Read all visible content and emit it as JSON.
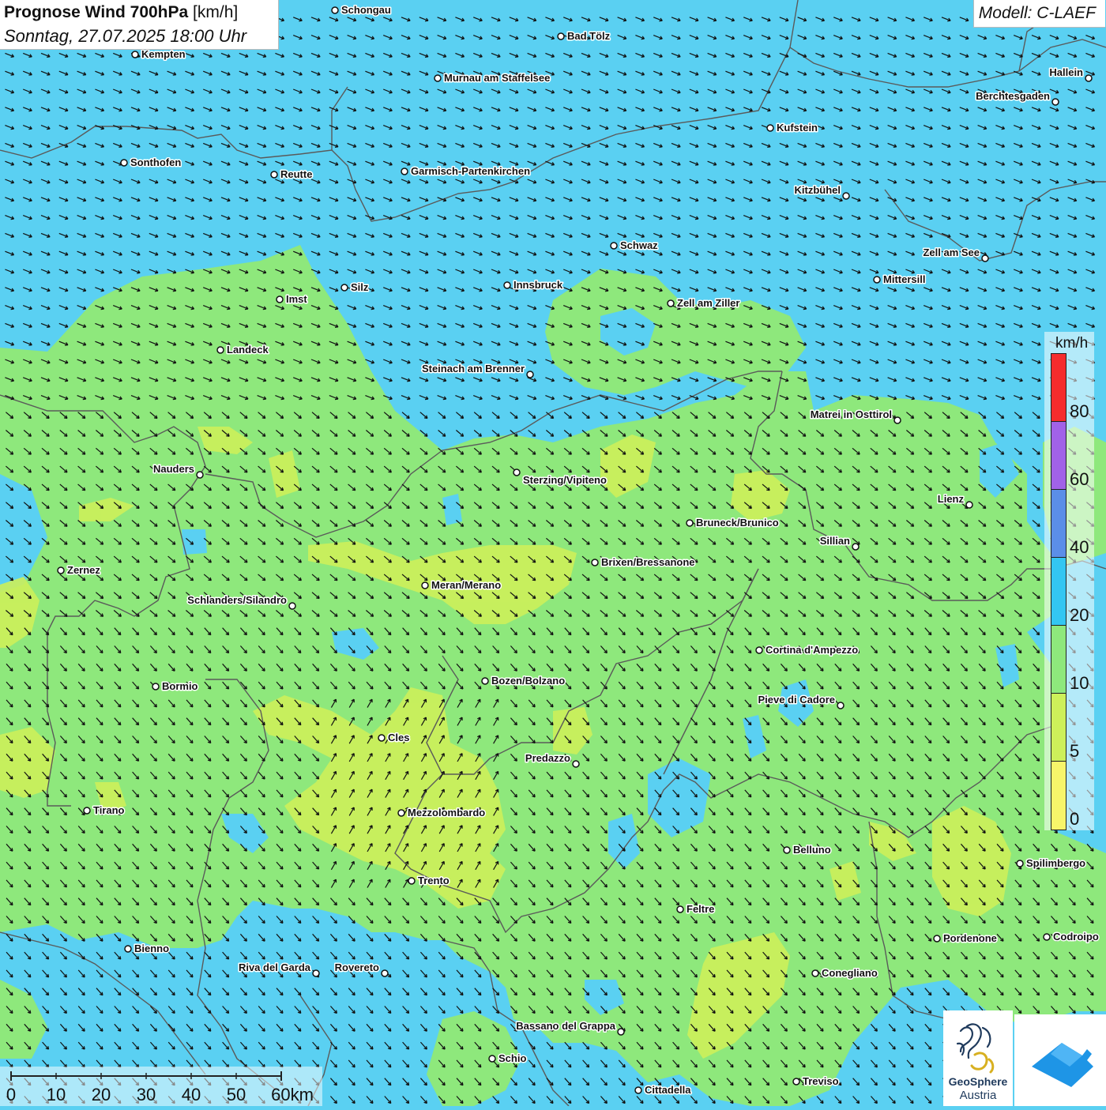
{
  "header": {
    "title_bold": "Prognose Wind 700hPa",
    "title_unit": "[km/h]",
    "datetime": "Sonntag, 27.07.2025 18:00 Uhr",
    "model": "Modell: C-LAEF"
  },
  "legend": {
    "unit": "km/h",
    "ticks": [
      "80",
      "60",
      "40",
      "20",
      "10",
      "5",
      "0"
    ],
    "colors": [
      "#f52c2c",
      "#a162e8",
      "#5b8ee8",
      "#33c6f2",
      "#8ee87c",
      "#cdf05a",
      "#f7f56a"
    ]
  },
  "scalebar": {
    "labels": [
      "0",
      "10",
      "20",
      "30",
      "40",
      "50",
      "60km"
    ]
  },
  "logos": {
    "geosphere_line1": "GeoSphere",
    "geosphere_line2": "Austria"
  },
  "map_colors": {
    "strong_wind": "#5ad0f2",
    "medium_wind": "#8ee87c",
    "weak_wind": "#cdf05a",
    "border": "#5a5a5a",
    "arrow": "#111111"
  },
  "cities": [
    {
      "name": "Schongau",
      "anchor": "right"
    },
    {
      "name": "Bad Tölz",
      "anchor": "right"
    },
    {
      "name": "Kempten",
      "anchor": "right"
    },
    {
      "name": "Murnau am Staffelsee",
      "anchor": "right"
    },
    {
      "name": "Hallein",
      "anchor": "left"
    },
    {
      "name": "Berchtesgaden",
      "anchor": "left"
    },
    {
      "name": "Kufstein",
      "anchor": "right"
    },
    {
      "name": "Sonthofen",
      "anchor": "right"
    },
    {
      "name": "Reutte",
      "anchor": "right"
    },
    {
      "name": "Garmisch-Partenkirchen",
      "anchor": "right"
    },
    {
      "name": "Kitzbühel",
      "anchor": "left"
    },
    {
      "name": "Schwaz",
      "anchor": "right"
    },
    {
      "name": "Zell am See",
      "anchor": "left"
    },
    {
      "name": "Innsbruck",
      "anchor": "right"
    },
    {
      "name": "Silz",
      "anchor": "right"
    },
    {
      "name": "Mittersill",
      "anchor": "right"
    },
    {
      "name": "Imst",
      "anchor": "right"
    },
    {
      "name": "Zell am Ziller",
      "anchor": "right"
    },
    {
      "name": "Landeck",
      "anchor": "right"
    },
    {
      "name": "Steinach am Brenner",
      "anchor": "left"
    },
    {
      "name": "Matrei in Osttirol",
      "anchor": "left"
    },
    {
      "name": "Nauders",
      "anchor": "left"
    },
    {
      "name": "Sterzing/Vipiteno",
      "anchor": "below"
    },
    {
      "name": "Lienz",
      "anchor": "left"
    },
    {
      "name": "Bruneck/Brunico",
      "anchor": "right"
    },
    {
      "name": "Sillian",
      "anchor": "left"
    },
    {
      "name": "Brixen/Bressanone",
      "anchor": "right"
    },
    {
      "name": "Zernez",
      "anchor": "right"
    },
    {
      "name": "Meran/Merano",
      "anchor": "right"
    },
    {
      "name": "Schlanders/Silandro",
      "anchor": "left"
    },
    {
      "name": "Cortina d'Ampezzo",
      "anchor": "right"
    },
    {
      "name": "Bozen/Bolzano",
      "anchor": "right"
    },
    {
      "name": "Bormio",
      "anchor": "right"
    },
    {
      "name": "Pieve di Cadore",
      "anchor": "left"
    },
    {
      "name": "Cles",
      "anchor": "right"
    },
    {
      "name": "Predazzo",
      "anchor": "left"
    },
    {
      "name": "Tirano",
      "anchor": "right"
    },
    {
      "name": "Mezzolombardo",
      "anchor": "right"
    },
    {
      "name": "Belluno",
      "anchor": "right"
    },
    {
      "name": "Spilimbergo",
      "anchor": "right"
    },
    {
      "name": "Trento",
      "anchor": "right"
    },
    {
      "name": "Feltre",
      "anchor": "right"
    },
    {
      "name": "Pordenone",
      "anchor": "right"
    },
    {
      "name": "Codroipo",
      "anchor": "right"
    },
    {
      "name": "Bienno",
      "anchor": "right"
    },
    {
      "name": "Riva del Garda",
      "anchor": "left"
    },
    {
      "name": "Rovereto",
      "anchor": "left"
    },
    {
      "name": "Conegliano",
      "anchor": "right"
    },
    {
      "name": "Bassano del Grappa",
      "anchor": "left"
    },
    {
      "name": "Schio",
      "anchor": "right"
    },
    {
      "name": "Treviso",
      "anchor": "right"
    },
    {
      "name": "Cittadella",
      "anchor": "right"
    }
  ]
}
